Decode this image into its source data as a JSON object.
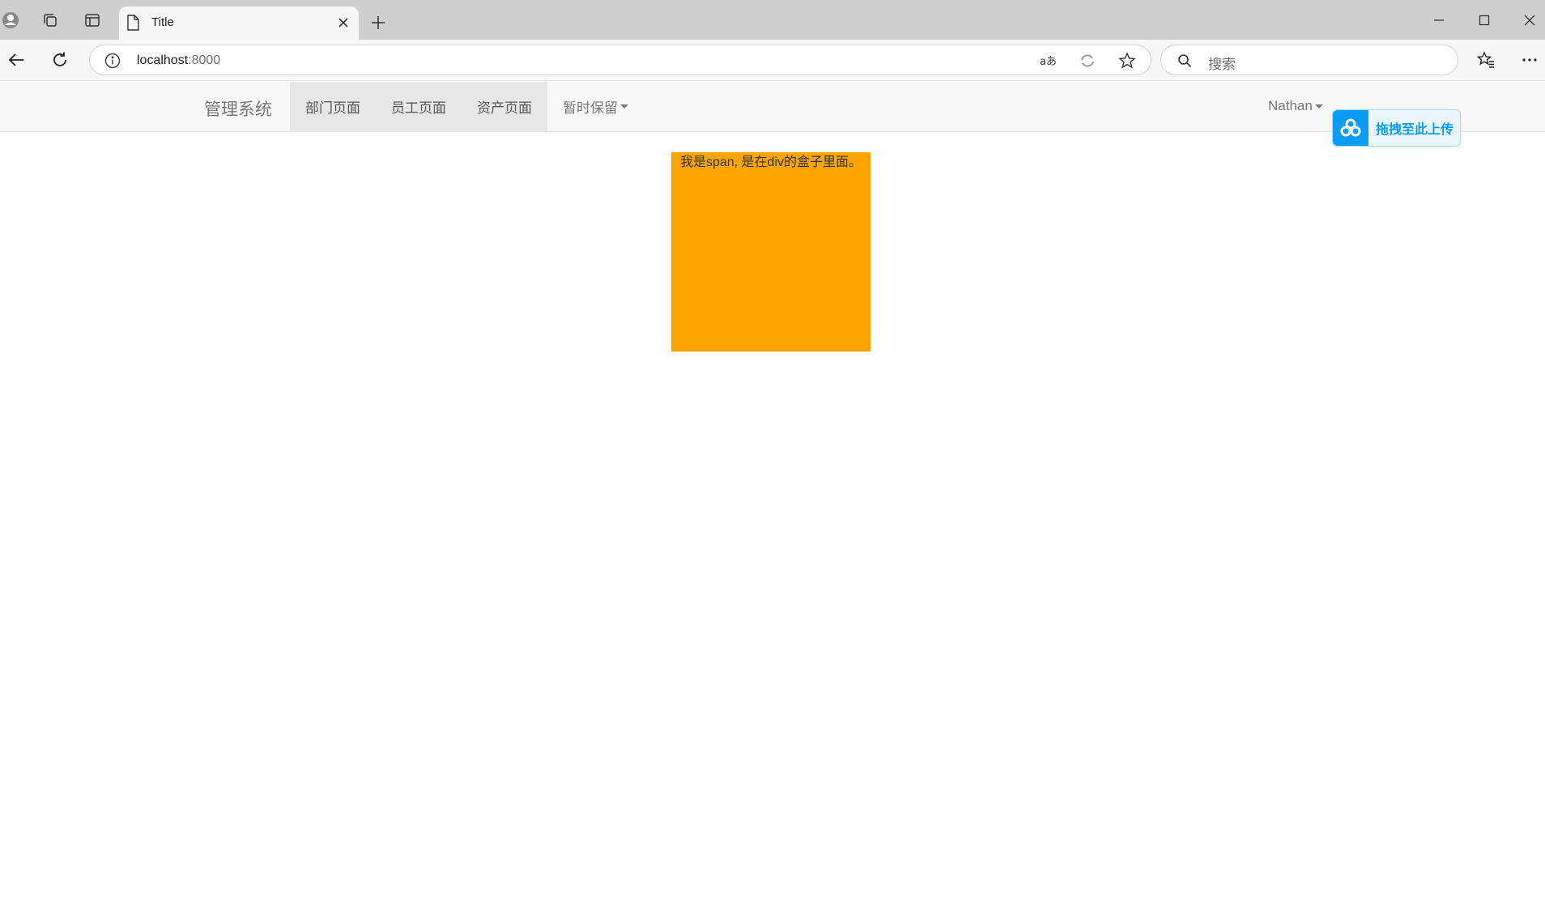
{
  "browser": {
    "tab_title": "Title",
    "url_host": "localhost",
    "url_port": ":8000",
    "search_placeholder": "搜索"
  },
  "navbar": {
    "brand": "管理系统",
    "links": [
      "部门页面",
      "员工页面",
      "资产页面"
    ],
    "dropdown_label": "暂时保留",
    "user": "Nathan"
  },
  "upload_widget": {
    "label": "拖拽至此上传",
    "accent": "#0b9cf7"
  },
  "content": {
    "box_text": "我是span, 是在div的盒子里面。",
    "box_color": "#ffa500"
  }
}
